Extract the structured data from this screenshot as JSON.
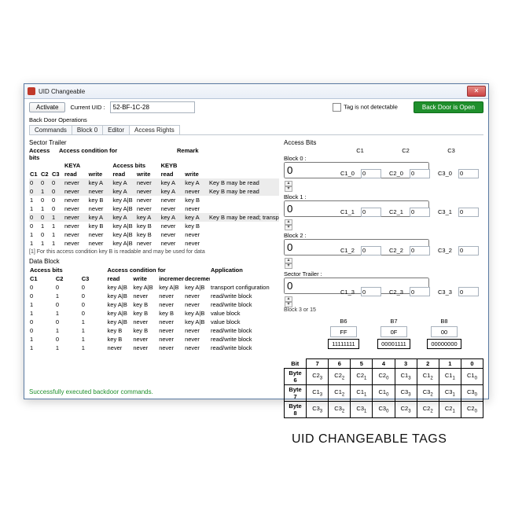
{
  "window": {
    "title": "UID Changeable"
  },
  "toolbar": {
    "activate": "Activate",
    "uid_label": "Current UID :",
    "uid_value": "52-BF-1C-28",
    "tag_not_detectable": "Tag is not detectable",
    "backdoor_badge": "Back Door is Open"
  },
  "section_title": "Back Door Operations",
  "tabs": [
    "Commands",
    "Block 0",
    "Editor",
    "Access Rights"
  ],
  "active_tab": 3,
  "sector_trailer_title": "Sector Trailer",
  "st_headers": {
    "access_bits": "Access bits",
    "cond": "Access condition for",
    "remark": "Remark",
    "keya": "KEYA",
    "access": "Access bits",
    "keyb": "KEYB",
    "c1": "C1",
    "c2": "C2",
    "c3": "C3",
    "read": "read",
    "write": "write"
  },
  "st_rows": [
    {
      "c": [
        "0",
        "0",
        "0"
      ],
      "ka": [
        "never",
        "key A"
      ],
      "ab": [
        "key A",
        "never"
      ],
      "kb": [
        "key A",
        "key A"
      ],
      "rem": "Key B may be read",
      "shade": true
    },
    {
      "c": [
        "0",
        "1",
        "0"
      ],
      "ka": [
        "never",
        "never"
      ],
      "ab": [
        "key A",
        "never"
      ],
      "kb": [
        "key A",
        "never"
      ],
      "rem": "Key B may be read",
      "shade": true
    },
    {
      "c": [
        "1",
        "0",
        "0"
      ],
      "ka": [
        "never",
        "key B"
      ],
      "ab": [
        "key A|B",
        "never"
      ],
      "kb": [
        "never",
        "key B"
      ],
      "rem": ""
    },
    {
      "c": [
        "1",
        "1",
        "0"
      ],
      "ka": [
        "never",
        "never"
      ],
      "ab": [
        "key A|B",
        "never"
      ],
      "kb": [
        "never",
        "never"
      ],
      "rem": ""
    },
    {
      "c": [
        "0",
        "0",
        "1"
      ],
      "ka": [
        "never",
        "key A"
      ],
      "ab": [
        "key A",
        "key A"
      ],
      "kb": [
        "key A",
        "key A"
      ],
      "rem": "Key B may be read; transport configuration",
      "shade": true
    },
    {
      "c": [
        "0",
        "1",
        "1"
      ],
      "ka": [
        "never",
        "key B"
      ],
      "ab": [
        "key A|B",
        "key B"
      ],
      "kb": [
        "never",
        "key B"
      ],
      "rem": ""
    },
    {
      "c": [
        "1",
        "0",
        "1"
      ],
      "ka": [
        "never",
        "never"
      ],
      "ab": [
        "key A|B",
        "key B"
      ],
      "kb": [
        "never",
        "never"
      ],
      "rem": ""
    },
    {
      "c": [
        "1",
        "1",
        "1"
      ],
      "ka": [
        "never",
        "never"
      ],
      "ab": [
        "key A|B",
        "never"
      ],
      "kb": [
        "never",
        "never"
      ],
      "rem": ""
    }
  ],
  "st_footnote": "[1]   For this access condition key B is readable and may be used for data",
  "data_block_title": "Data Block",
  "db_headers": {
    "access_bits": "Access bits",
    "cond": "Access condition for",
    "app": "Application",
    "c1": "C1",
    "c2": "C2",
    "c3": "C3",
    "read": "read",
    "write": "write",
    "inc": "increment",
    "dec": "decrement, transfer, restore"
  },
  "db_rows": [
    {
      "c": [
        "0",
        "0",
        "0"
      ],
      "r": "key A|B",
      "w": "key A|B",
      "i": "key A|B",
      "d": "key A|B",
      "app": "transport configuration"
    },
    {
      "c": [
        "0",
        "1",
        "0"
      ],
      "r": "key A|B",
      "w": "never",
      "i": "never",
      "d": "never",
      "app": "read/write block"
    },
    {
      "c": [
        "1",
        "0",
        "0"
      ],
      "r": "key A|B",
      "w": "key B",
      "i": "never",
      "d": "never",
      "app": "read/write block"
    },
    {
      "c": [
        "1",
        "1",
        "0"
      ],
      "r": "key A|B",
      "w": "key B",
      "i": "key B",
      "d": "key A|B",
      "app": "value block"
    },
    {
      "c": [
        "0",
        "0",
        "1"
      ],
      "r": "key A|B",
      "w": "never",
      "i": "never",
      "d": "key A|B",
      "app": "value block"
    },
    {
      "c": [
        "0",
        "1",
        "1"
      ],
      "r": "key B",
      "w": "key B",
      "i": "never",
      "d": "never",
      "app": "read/write block"
    },
    {
      "c": [
        "1",
        "0",
        "1"
      ],
      "r": "key B",
      "w": "never",
      "i": "never",
      "d": "never",
      "app": "read/write block"
    },
    {
      "c": [
        "1",
        "1",
        "1"
      ],
      "r": "never",
      "w": "never",
      "i": "never",
      "d": "never",
      "app": "read/write block"
    }
  ],
  "access_bits_title": "Access Bits",
  "ab_rows": [
    {
      "label": "Block 0 :",
      "val": "0"
    },
    {
      "label": "Block 1 :",
      "val": "0"
    },
    {
      "label": "Block 2 :",
      "val": "0"
    },
    {
      "label": "Sector Trailer :",
      "val": "0",
      "sub": "Block 3 or 15"
    }
  ],
  "c_cols": [
    "C1",
    "C2",
    "C3"
  ],
  "c_grid": [
    [
      {
        "l": "C1_0",
        "v": "0"
      },
      {
        "l": "C2_0",
        "v": "0"
      },
      {
        "l": "C3_0",
        "v": "0"
      }
    ],
    [
      {
        "l": "C1_1",
        "v": "0"
      },
      {
        "l": "C2_1",
        "v": "0"
      },
      {
        "l": "C3_1",
        "v": "0"
      }
    ],
    [
      {
        "l": "C1_2",
        "v": "0"
      },
      {
        "l": "C2_2",
        "v": "0"
      },
      {
        "l": "C3_2",
        "v": "0"
      }
    ],
    [
      {
        "l": "C1_3",
        "v": "0"
      },
      {
        "l": "C2_3",
        "v": "0"
      },
      {
        "l": "C3_3",
        "v": "0"
      }
    ]
  ],
  "bytes": [
    {
      "name": "B6",
      "hex": "FF",
      "bin": "11111111"
    },
    {
      "name": "B7",
      "hex": "0F",
      "bin": "00001111"
    },
    {
      "name": "B8",
      "hex": "00",
      "bin": "00000000"
    }
  ],
  "bit_header": [
    "Bit",
    "7",
    "6",
    "5",
    "4",
    "3",
    "2",
    "1",
    "0"
  ],
  "bit_rows": [
    {
      "name": "Byte 6",
      "cells": [
        "C2₃",
        "C2₂",
        "C2₁",
        "C2₀",
        "C1₃",
        "C1₂",
        "C1₁",
        "C1₀"
      ]
    },
    {
      "name": "Byte 7",
      "cells": [
        "C1₃",
        "C1₂",
        "C1₁",
        "C1₀",
        "C3₃",
        "C3₂",
        "C3₁",
        "C3₀"
      ]
    },
    {
      "name": "Byte 8",
      "cells": [
        "C3₃",
        "C3₂",
        "C3₁",
        "C3₀",
        "C2₃",
        "C2₂",
        "C2₁",
        "C2₀"
      ]
    }
  ],
  "big_title": "UID CHANGEABLE TAGS",
  "status_msg": "Successfully executed backdoor commands."
}
